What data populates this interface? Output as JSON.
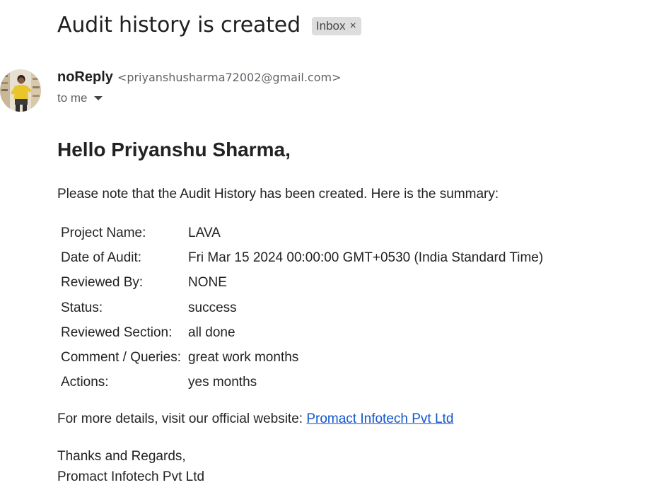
{
  "email": {
    "subject": "Audit history is created",
    "label": "Inbox",
    "label_remove_glyph": "×",
    "sender": {
      "name": "noReply",
      "email": "<priyanshusharma72002@gmail.com>",
      "avatar_icon": "user-photo-avatar"
    },
    "recipient_text": "to me",
    "recipient_icon": "caret-down-icon"
  },
  "body": {
    "greeting": "Hello Priyanshu Sharma,",
    "intro": "Please note that the Audit History has been created. Here is the summary:",
    "summary": [
      {
        "key": "Project Name:",
        "value": "LAVA"
      },
      {
        "key": "Date of Audit:",
        "value": "Fri Mar 15 2024 00:00:00 GMT+0530 (India Standard Time)"
      },
      {
        "key": "Reviewed By:",
        "value": "NONE"
      },
      {
        "key": "Status:",
        "value": "success"
      },
      {
        "key": "Reviewed Section:",
        "value": "all done"
      },
      {
        "key": "Comment / Queries:",
        "value": "great work months"
      },
      {
        "key": "Actions:",
        "value": "yes months"
      }
    ],
    "details_prefix": "For more details, visit our official website: ",
    "details_link": "Promact Infotech Pvt Ltd",
    "signoff_line1": "Thanks and Regards,",
    "signoff_line2": "Promact Infotech Pvt Ltd"
  },
  "colors": {
    "link": "#1155cc",
    "chip_bg": "#dddddd",
    "muted_text": "#5f6368"
  }
}
